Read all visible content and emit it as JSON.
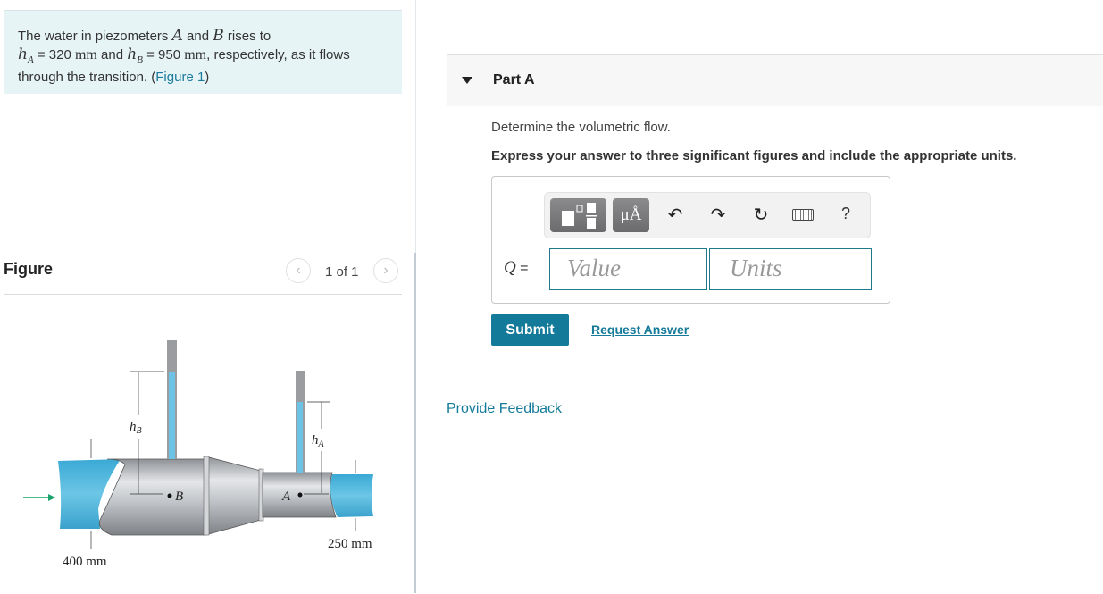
{
  "intro": {
    "text_1": "The water in piezometers ",
    "var_A": "A",
    "text_2": " and ",
    "var_B": "B",
    "text_3": " rises to",
    "hA_symbol": "h",
    "hA_sub": "A",
    "hA_eq": " = 320 ",
    "hA_unit": "mm",
    "text_4": " and ",
    "hB_symbol": "h",
    "hB_sub": "B",
    "hB_eq": " = 950 ",
    "hB_unit": "mm",
    "text_5": ", respectively, as it flows through the transition. (",
    "figure_link": "Figure 1",
    "text_6": ")"
  },
  "figure_panel": {
    "title": "Figure",
    "pager_text": "1 of 1",
    "prev_icon": "chevron-left-icon",
    "next_icon": "chevron-right-icon",
    "diagram": {
      "label_hB": "h",
      "label_hB_sub": "B",
      "label_hA": "h",
      "label_hA_sub": "A",
      "point_B": "B",
      "point_A": "A",
      "dim_inlet": "400 mm",
      "dim_outlet": "250 mm",
      "water_color": "#4fb3d6",
      "pipe_color": "#b9bcc0",
      "flow_arrow_color": "#1aa36b"
    }
  },
  "partA": {
    "title": "Part A",
    "question": "Determine the volumetric flow.",
    "instructions": "Express your answer to three significant figures and include the appropriate units.",
    "toolbar": {
      "templates_icon": "templates-icon",
      "units_label": "μÅ",
      "undo_icon": "↶",
      "redo_icon": "↷",
      "reset_icon": "↻",
      "keyboard_icon": "keyboard-icon",
      "help_label": "?"
    },
    "answer": {
      "variable": "Q",
      "equals": " =",
      "value_placeholder": "Value",
      "units_placeholder": "Units"
    },
    "submit_label": "Submit",
    "request_answer_label": "Request Answer"
  },
  "feedback_label": "Provide Feedback",
  "colors": {
    "accent": "#147a99",
    "intro_bg": "#e6f4f6",
    "header_bg": "#f7f7f7"
  }
}
